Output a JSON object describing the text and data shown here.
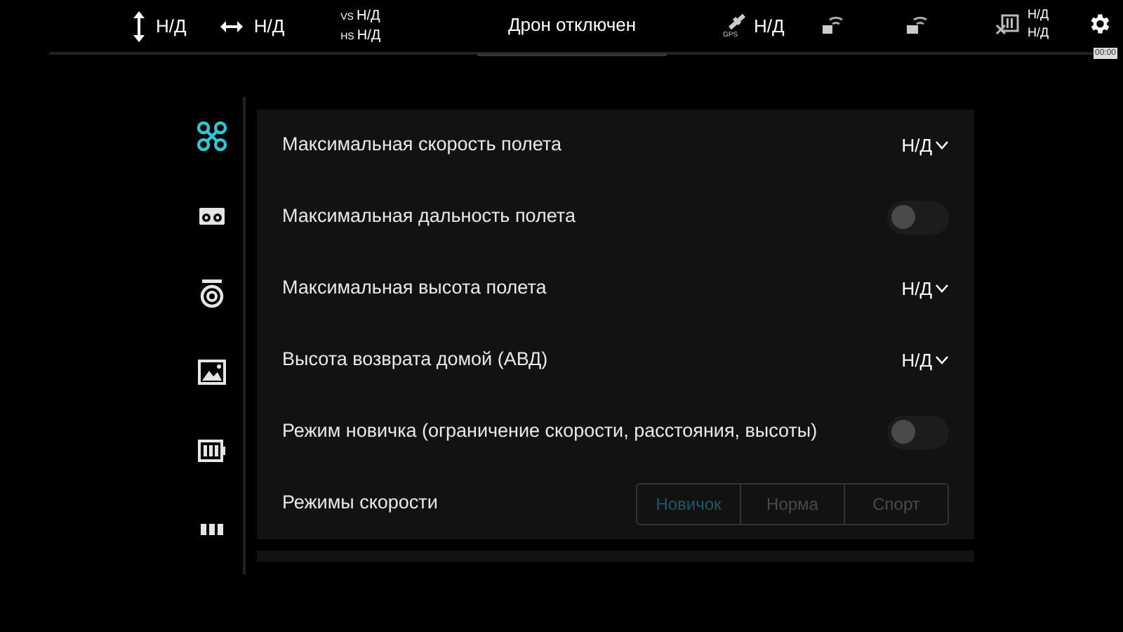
{
  "status_bar": {
    "altitude": "Н/Д",
    "distance": "Н/Д",
    "vs_label": "VS",
    "vs": "Н/Д",
    "hs_label": "HS",
    "hs": "Н/Д",
    "title": "Дрон отключен",
    "gps_label": "GPS",
    "gps": "Н/Д",
    "battery_top": "Н/Д",
    "battery_bottom": "Н/Д",
    "timer": "00:00"
  },
  "sidebar": {
    "items": [
      {
        "kind": "drone",
        "selected": true
      },
      {
        "kind": "remote",
        "selected": false
      },
      {
        "kind": "camera",
        "selected": false
      },
      {
        "kind": "image",
        "selected": false
      },
      {
        "kind": "battery",
        "selected": false
      },
      {
        "kind": "more",
        "selected": false
      }
    ]
  },
  "settings": [
    {
      "kind": "dropdown",
      "label": "Максимальная скорость полета",
      "value": "Н/Д"
    },
    {
      "kind": "toggle",
      "label": "Максимальная дальность полета",
      "on": false
    },
    {
      "kind": "dropdown",
      "label": "Максимальная высота полета",
      "value": "Н/Д"
    },
    {
      "kind": "dropdown",
      "label": "Высота возврата домой (АВД)",
      "value": "Н/Д"
    },
    {
      "kind": "toggle",
      "label": "Режим новичка (ограничение скорости, расстояния, высоты)",
      "on": false
    },
    {
      "kind": "segmented",
      "label": "Режимы скорости",
      "options": [
        {
          "label": "Новичок",
          "selected": true
        },
        {
          "label": "Норма",
          "selected": false
        },
        {
          "label": "Спорт",
          "selected": false
        }
      ]
    }
  ]
}
